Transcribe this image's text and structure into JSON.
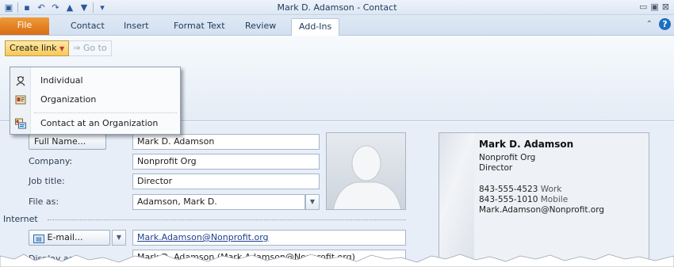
{
  "window": {
    "title": "Mark D. Adamson - Contact"
  },
  "ribbon": {
    "tabs": [
      "File",
      "Contact",
      "Insert",
      "Format Text",
      "Review",
      "Add-Ins"
    ],
    "active_tab": "Add-Ins",
    "create_link_label": "Create link",
    "goto_label": "Go to"
  },
  "menu": {
    "items": [
      {
        "label": "Individual",
        "icon": "individual-icon"
      },
      {
        "label": "Organization",
        "icon": "organization-icon"
      },
      {
        "label": "Contact at an Organization",
        "icon": "contact-at-organization-icon"
      }
    ]
  },
  "form": {
    "full_name_button": "Full Name...",
    "full_name_value": "Mark D. Adamson",
    "company_label": "Company:",
    "company_value": "Nonprofit Org",
    "job_title_label": "Job title:",
    "job_title_value": "Director",
    "file_as_label": "File as:",
    "file_as_value": "Adamson, Mark D.",
    "internet_section": "Internet",
    "email_button": "E-mail...",
    "email_value": "Mark.Adamson@Nonprofit.org",
    "display_as_label": "Display as:",
    "display_as_value": "Mark D. Adamson (Mark.Adamson@Nonprofit.org)"
  },
  "business_card": {
    "name": "Mark D. Adamson",
    "company": "Nonprofit Org",
    "title": "Director",
    "phone_work": "843-555-4523",
    "phone_work_type": "Work",
    "phone_mobile": "843-555-1010",
    "phone_mobile_type": "Mobile",
    "email": "Mark.Adamson@Nonprofit.org"
  },
  "colors": {
    "file_tab": "#d96d13",
    "create_link": "#f8c85a",
    "link_text": "#1b3f8f"
  }
}
